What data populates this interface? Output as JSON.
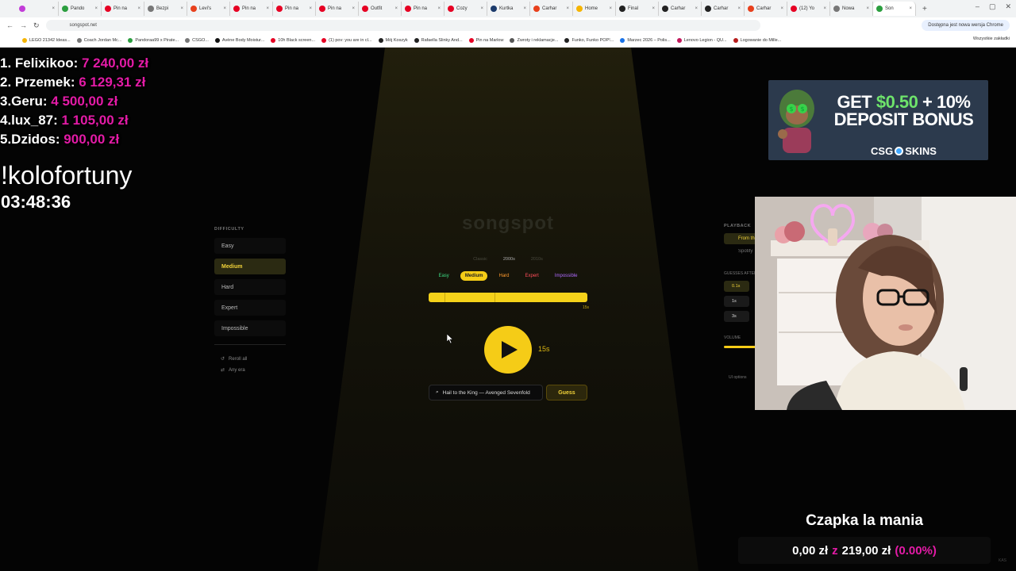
{
  "browser": {
    "tabs": [
      {
        "label": "",
        "color": "#c23dd8",
        "active": false
      },
      {
        "label": "Pando",
        "color": "#2b9e3f",
        "active": false
      },
      {
        "label": "Pin na",
        "color": "#e60023",
        "active": false
      },
      {
        "label": "Bezpi",
        "color": "#777777",
        "active": false
      },
      {
        "label": "Levi's",
        "color": "#e8401c",
        "active": false
      },
      {
        "label": "Pin na",
        "color": "#e60023",
        "active": false
      },
      {
        "label": "Pin na",
        "color": "#e60023",
        "active": false
      },
      {
        "label": "Pin na",
        "color": "#e60023",
        "active": false
      },
      {
        "label": "Outfit",
        "color": "#e60023",
        "active": false
      },
      {
        "label": "Pin na",
        "color": "#e60023",
        "active": false
      },
      {
        "label": "Cozy",
        "color": "#e60023",
        "active": false
      },
      {
        "label": "Kurtka",
        "color": "#1b3a6b",
        "active": false
      },
      {
        "label": "Carhar",
        "color": "#e8401c",
        "active": false
      },
      {
        "label": "Home",
        "color": "#f5b400",
        "active": false
      },
      {
        "label": "Final",
        "color": "#222222",
        "active": false
      },
      {
        "label": "Carhar",
        "color": "#222222",
        "active": false
      },
      {
        "label": "Carhar",
        "color": "#222222",
        "active": false
      },
      {
        "label": "Carhar",
        "color": "#e8401c",
        "active": false
      },
      {
        "label": "(12) Yo",
        "color": "#e60023",
        "active": false
      },
      {
        "label": "Nowa",
        "color": "#777777",
        "active": false
      },
      {
        "label": "Son",
        "color": "#2b9e3f",
        "active": true
      }
    ],
    "url": "songspot.net",
    "update_chip": "Dostępna jest nowa wersja Chrome",
    "bookmarks": [
      {
        "label": "LEGO 21342 Ideas...",
        "color": "#f5b400"
      },
      {
        "label": "Coach Jordan Mc...",
        "color": "#777777"
      },
      {
        "label": "Pandoraa99 x Pirate...",
        "color": "#2b9e3f"
      },
      {
        "label": "CSGO...",
        "color": "#777777"
      },
      {
        "label": "Avène Body Moistur...",
        "color": "#111111"
      },
      {
        "label": "10h Black screen...",
        "color": "#e60023"
      },
      {
        "label": "(1) pov: you are in cl...",
        "color": "#e60023"
      },
      {
        "label": "Mój Koszyk",
        "color": "#222222"
      },
      {
        "label": "Rafaella Slinky And...",
        "color": "#222222"
      },
      {
        "label": "Pin na Marlow",
        "color": "#e60023"
      },
      {
        "label": "Zwroty i reklamacje...",
        "color": "#555555"
      },
      {
        "label": "Funko, Funko POP!...",
        "color": "#222222"
      },
      {
        "label": "Marzec 2026 – Polis...",
        "color": "#1a73e8"
      },
      {
        "label": "Lenovo Legion - QU...",
        "color": "#c2185b"
      },
      {
        "label": "Logowanie do Mille...",
        "color": "#b71c1c"
      }
    ],
    "all_bookmarks": "Wszystkie zakładki"
  },
  "leaderboard": [
    {
      "rank_name": "1. Felixikoo:",
      "amount": "7 240,00 zł"
    },
    {
      "rank_name": "2. Przemek:",
      "amount": "6 129,31 zł"
    },
    {
      "rank_name": "3.Geru:",
      "amount": "4 500,00 zł"
    },
    {
      "rank_name": "4.lux_87:",
      "amount": "1 105,00 zł"
    },
    {
      "rank_name": "5.Dzidos:",
      "amount": "900,00 zł"
    }
  ],
  "command": "!kolofortuny",
  "timer": "03:48:36",
  "difficulty_panel": {
    "title": "DIFFICULTY",
    "items": [
      "Easy",
      "Medium",
      "Hard",
      "Expert",
      "Impossible"
    ],
    "selected": "Medium",
    "reroll": "Reroll all",
    "any_era": "Any era"
  },
  "game": {
    "logo": "songspot",
    "eras": [
      "Classic",
      "2000s",
      "2010s"
    ],
    "active_era": "2000s",
    "pills": {
      "easy": "Easy",
      "medium": "Medium",
      "hard": "Hard",
      "expert": "Expert",
      "impossible": "Impossible"
    },
    "progress_end": "15s",
    "duration": "15s",
    "search_value": "Hail to the King — Avenged Sevenfold",
    "guess_label": "Guess"
  },
  "right_panel": {
    "playback_title": "PLAYBACK",
    "from_label": "From the start",
    "spotify_label": "Spotify",
    "guesses_title": "GUESSES AFTER",
    "guess_chips": [
      "0.1s",
      "1s",
      "3s"
    ],
    "volume_title": "VOLUME",
    "volume_level": 1.0,
    "ui_options": "UI options"
  },
  "ad": {
    "line1_prefix": "GET ",
    "line1_green": "$0.50",
    "line1_suffix": " + 10%",
    "line2": "DEPOSIT BONUS",
    "brand_left": "CSG",
    "brand_right": "SKINS"
  },
  "goal": {
    "title": "Czapka la mania",
    "current": "0,00 zł",
    "sep": "z",
    "target": "219,00 zł",
    "percent": "(0.00%)"
  },
  "corner_mark": "KAS"
}
